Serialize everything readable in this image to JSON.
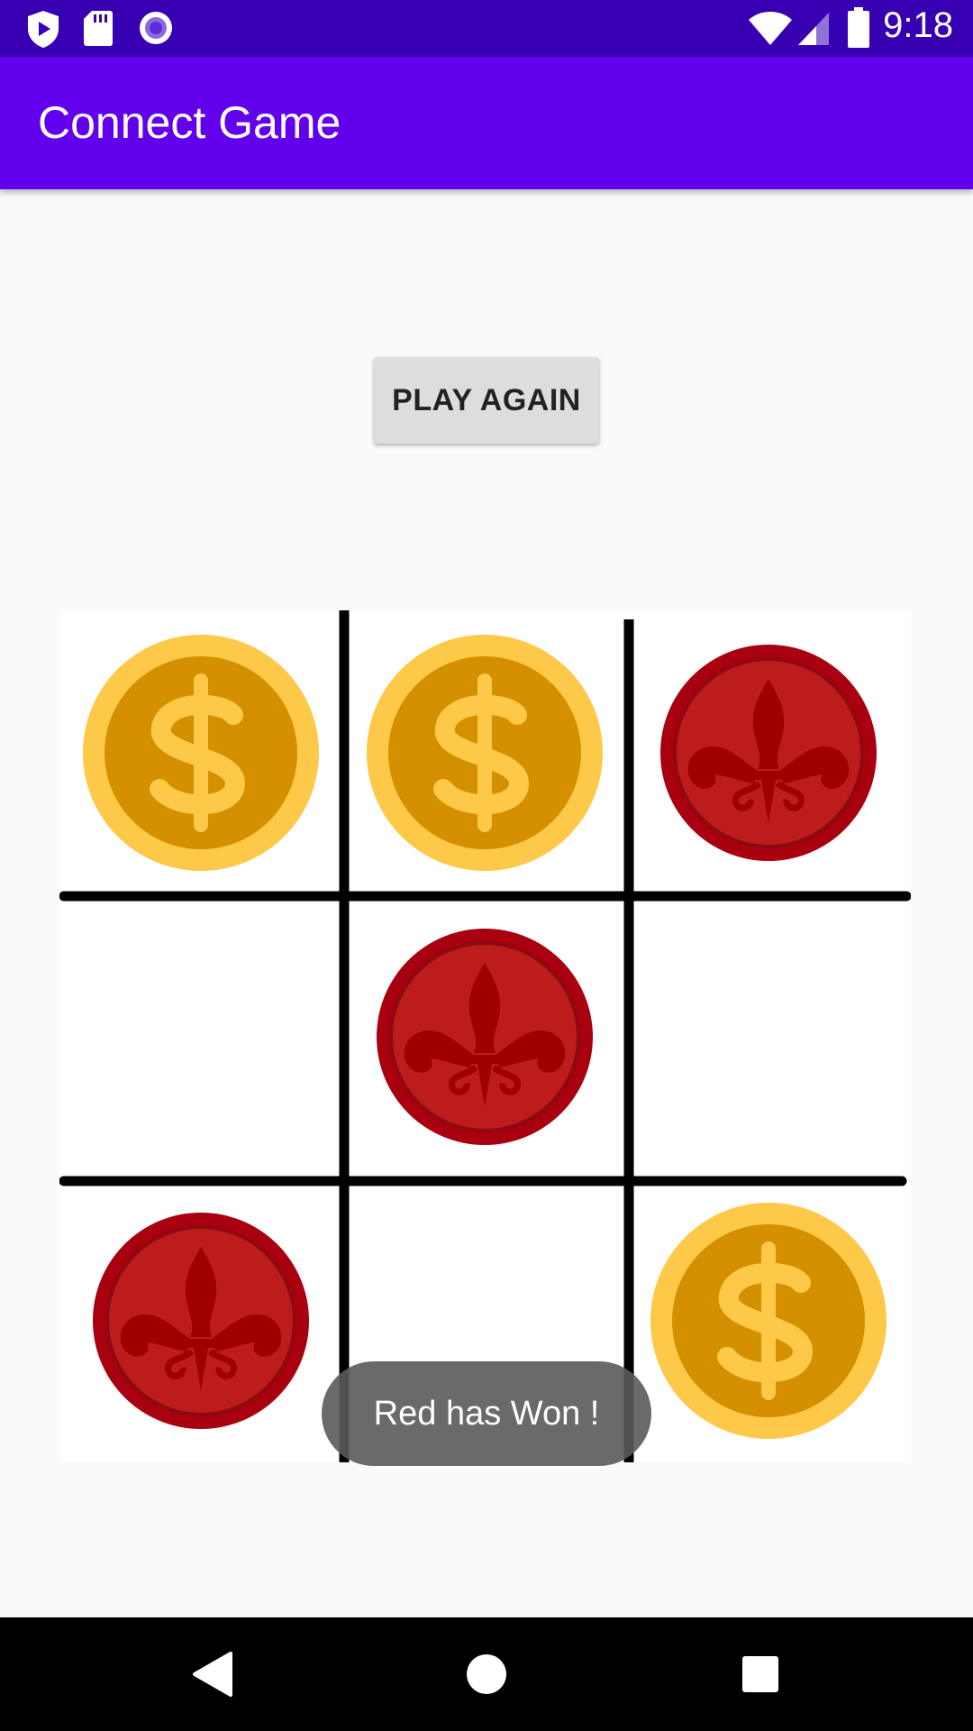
{
  "status_bar": {
    "time": "9:18",
    "left_icons": [
      "shield-play-icon",
      "sd-card-icon",
      "circle-dot-icon"
    ],
    "right_icons": [
      "wifi-icon",
      "signal-icon",
      "battery-icon"
    ]
  },
  "app_bar": {
    "title": "Connect Game",
    "color": "#6200ee"
  },
  "play_again_label": "PLAY AGAIN",
  "board": {
    "rows": [
      [
        "gold",
        "gold",
        "red"
      ],
      [
        "empty",
        "red",
        "empty"
      ],
      [
        "red",
        "empty",
        "gold"
      ]
    ],
    "gold_colors": {
      "outer": "#fec848",
      "inner": "#d59000"
    },
    "red_colors": {
      "outer": "#a8000f",
      "inner": "#bd1c1c",
      "symbol": "#9e0000"
    }
  },
  "toast": "Red has Won !",
  "nav_bar": {
    "buttons": [
      "back-icon",
      "home-icon",
      "recents-icon"
    ]
  }
}
